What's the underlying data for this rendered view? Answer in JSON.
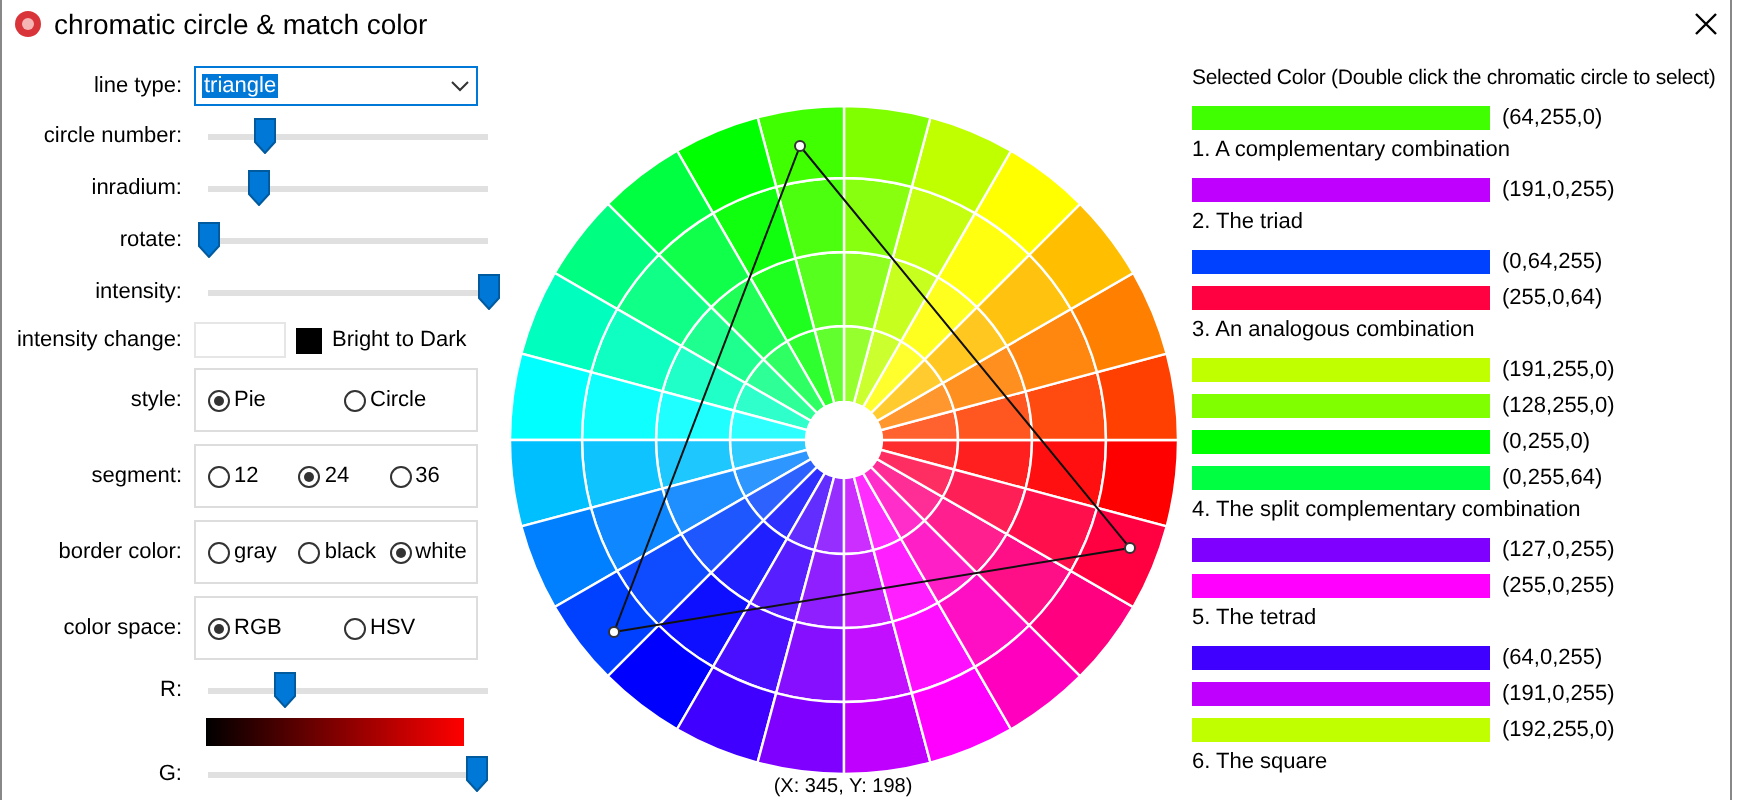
{
  "window": {
    "title": "chromatic circle & match color"
  },
  "controls": [
    {
      "kind": "dropdown",
      "label": "line type:",
      "value": "triangle",
      "highlighted": true
    },
    {
      "kind": "slider",
      "label": "circle number:",
      "level": 0.2
    },
    {
      "kind": "slider",
      "label": "inradium:",
      "level": 0.18
    },
    {
      "kind": "slider",
      "label": "rotate:",
      "level": 0
    },
    {
      "kind": "slider",
      "label": "intensity:",
      "level": 1
    },
    {
      "kind": "toggle",
      "label": "intensity change:",
      "color": "#000000",
      "text": "Bright to Dark"
    },
    {
      "kind": "radio",
      "label": "style:",
      "options": [
        {
          "label": "Pie",
          "selected": true
        },
        {
          "label": "Circle",
          "selected": false
        }
      ]
    },
    {
      "kind": "radio",
      "label": "segment:",
      "options": [
        {
          "label": "12",
          "selected": false
        },
        {
          "label": "24",
          "selected": true
        },
        {
          "label": "36",
          "selected": false
        }
      ]
    },
    {
      "kind": "radio",
      "label": "border color:",
      "options": [
        {
          "label": "gray",
          "selected": false
        },
        {
          "label": "black",
          "selected": false
        },
        {
          "label": "white",
          "selected": true
        }
      ]
    },
    {
      "kind": "radio",
      "label": "color space:",
      "options": [
        {
          "label": "RGB",
          "selected": true
        },
        {
          "label": "HSV",
          "selected": false
        }
      ]
    },
    {
      "kind": "slider",
      "label": "R:",
      "level": 0.27
    },
    {
      "kind": "gradient",
      "color": "#ff0000"
    },
    {
      "kind": "slider",
      "label": "G:",
      "level": 0.96
    }
  ],
  "wheel": {
    "coordinates": "(X: 345, Y: 198)"
  },
  "selected_color": {
    "heading": "Selected Color (Double click the chromatic circle to select)",
    "swatches": [
      {
        "color": "#40ff00",
        "value": "(64,255,0)"
      }
    ]
  },
  "combinations": [
    {
      "title": "1. A complementary combination",
      "swatches": [
        {
          "color": "#bf00ff",
          "value": "(191,0,255)"
        }
      ]
    },
    {
      "title": "2. The triad",
      "swatches": [
        {
          "color": "#0040ff",
          "value": "(0,64,255)"
        },
        {
          "color": "#ff0040",
          "value": "(255,0,64)"
        }
      ]
    },
    {
      "title": "3. An analogous combination",
      "swatches": [
        {
          "color": "#bfff00",
          "value": "(191,255,0)"
        },
        {
          "color": "#80ff00",
          "value": "(128,255,0)"
        },
        {
          "color": "#00ff00",
          "value": "(0,255,0)"
        },
        {
          "color": "#00ff40",
          "value": "(0,255,64)"
        }
      ]
    },
    {
      "title": "4. The split complementary combination",
      "swatches": [
        {
          "color": "#7f00ff",
          "value": "(127,0,255)"
        },
        {
          "color": "#ff00ff",
          "value": "(255,0,255)"
        }
      ]
    },
    {
      "title": "5. The tetrad",
      "swatches": [
        {
          "color": "#4000ff",
          "value": "(64,0,255)"
        },
        {
          "color": "#bf00ff",
          "value": "(191,0,255)"
        },
        {
          "color": "#c0ff00",
          "value": "(192,255,0)"
        }
      ]
    },
    {
      "title": "6. The square"
    }
  ]
}
